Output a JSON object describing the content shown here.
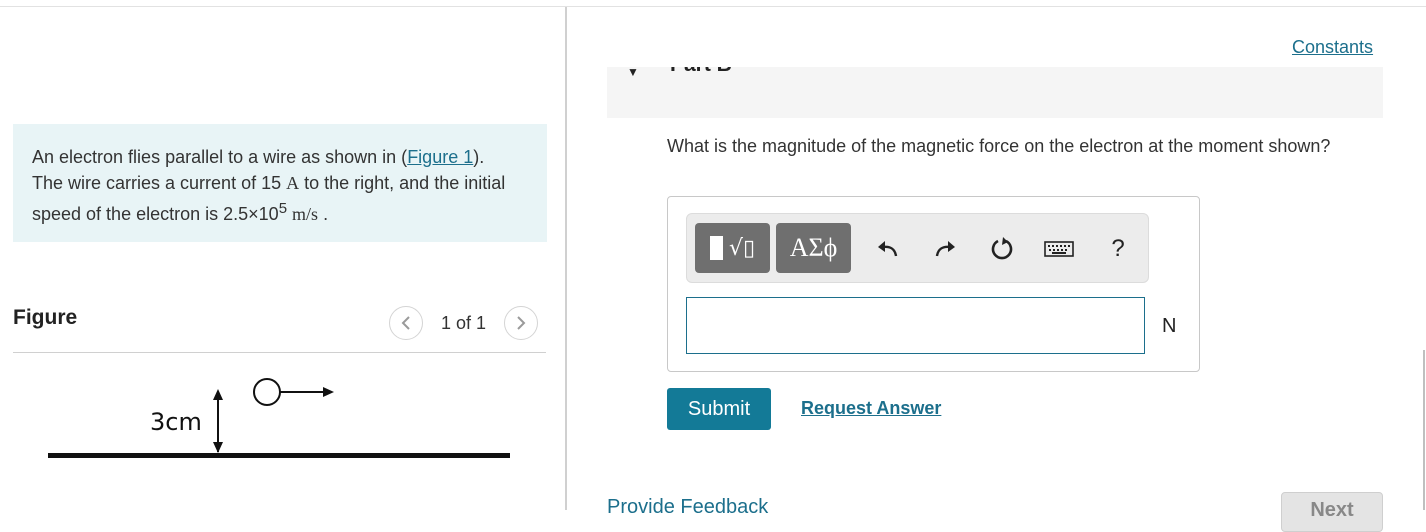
{
  "problem": {
    "text_before_link": "An electron flies parallel to a wire as shown in (",
    "figure_link": "Figure 1",
    "text_after_link": "). The wire carries a current of 15 ",
    "current_unit": "A",
    "text_mid": " to the right, and the initial speed of the electron is 2.5×10",
    "speed_exponent": "5",
    "speed_unit": "m/s",
    "text_end": " ."
  },
  "figure": {
    "label": "Figure",
    "pager": "1 of 1",
    "prev_icon": "chevron-left-icon",
    "next_icon": "chevron-right-icon",
    "distance_label": "3cm"
  },
  "right": {
    "constants_link": "Constants",
    "part_title": "Part B",
    "question": "What is the magnitude of the magnetic force on the electron at the moment shown?",
    "toolbar": {
      "templates_icon": "templates-icon",
      "greek_label": "ΑΣϕ",
      "undo_icon": "undo-icon",
      "redo_icon": "redo-icon",
      "reset_icon": "reset-icon",
      "keyboard_icon": "keyboard-icon",
      "help_label": "?"
    },
    "answer_value": "",
    "unit": "N",
    "submit_label": "Submit",
    "request_answer_label": "Request Answer",
    "feedback_link": "Provide Feedback",
    "next_label": "Next"
  },
  "colors": {
    "accent": "#137a97",
    "link": "#1c6f8c",
    "problem_bg": "#e8f4f6",
    "toolbar_button": "#6f6f6f"
  }
}
